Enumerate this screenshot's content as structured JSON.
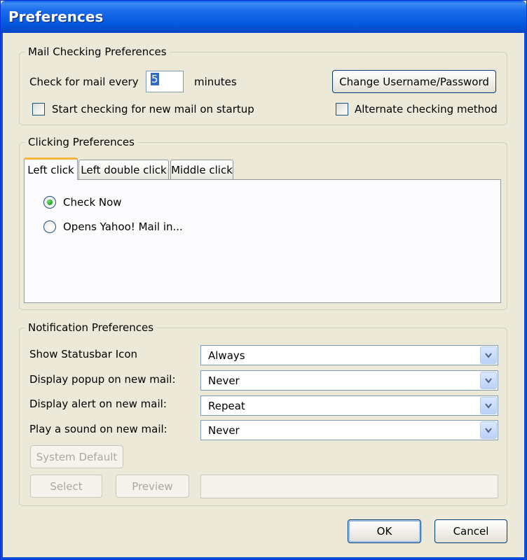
{
  "window": {
    "title": "Preferences"
  },
  "mail_checking": {
    "legend": "Mail Checking Preferences",
    "check_every_label": "Check for mail every",
    "interval_value": "5",
    "minutes_label": "minutes",
    "change_credentials_button": "Change Username/Password",
    "start_on_startup_label": "Start checking for new mail on startup",
    "start_on_startup_checked": false,
    "alternate_method_label": "Alternate checking method",
    "alternate_method_checked": false
  },
  "clicking": {
    "legend": "Clicking Preferences",
    "tabs": [
      {
        "label": "Left click",
        "active": true
      },
      {
        "label": "Left double click",
        "active": false
      },
      {
        "label": "Middle click",
        "active": false
      }
    ],
    "options": [
      {
        "label": "Check Now",
        "selected": true
      },
      {
        "label": "Opens Yahoo! Mail in...",
        "selected": false
      }
    ]
  },
  "notification": {
    "legend": "Notification Preferences",
    "rows": [
      {
        "label": "Show Statusbar Icon",
        "value": "Always"
      },
      {
        "label": "Display popup on new mail:",
        "value": "Never"
      },
      {
        "label": "Display alert on new mail:",
        "value": "Repeat"
      },
      {
        "label": "Play a sound on new mail:",
        "value": "Never"
      }
    ],
    "system_default_button": "System Default",
    "select_button": "Select",
    "preview_button": "Preview",
    "sound_path_value": ""
  },
  "footer": {
    "ok_button": "OK",
    "cancel_button": "Cancel"
  },
  "colors": {
    "titlebar": "#0559e0",
    "dialog_bg": "#ece9d8",
    "active_tab_accent": "#f8b43a",
    "radio_selected": "#21a121"
  }
}
